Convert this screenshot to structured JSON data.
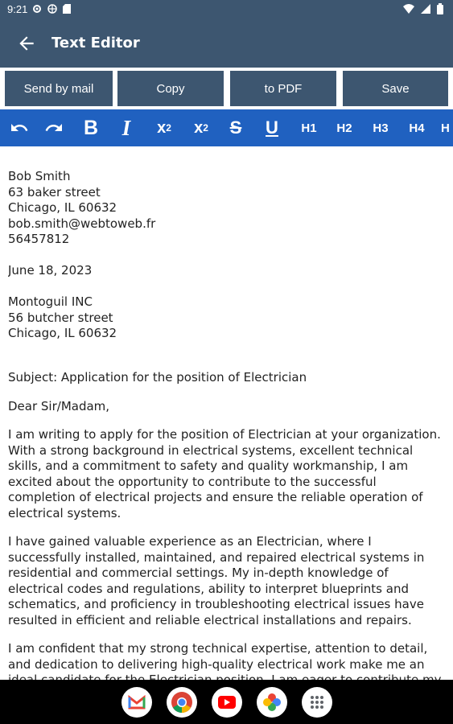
{
  "status": {
    "time": "9:21"
  },
  "app": {
    "title": "Text Editor"
  },
  "actions": {
    "send": "Send by mail",
    "copy": "Copy",
    "pdf": "to PDF",
    "save": "Save"
  },
  "toolbar": {
    "h1": "H1",
    "h2": "H2",
    "h3": "H3",
    "h4": "H4",
    "h5": "H"
  },
  "letter": {
    "sender": [
      "Bob Smith",
      "63 baker street",
      "Chicago, IL 60632",
      "bob.smith@webtoweb.fr",
      "56457812"
    ],
    "date": "June 18, 2023",
    "recipient": [
      "Montoguil INC",
      "56 butcher street",
      "Chicago, IL 60632"
    ],
    "subject": "Subject: Application for the position of Electrician",
    "greeting": "Dear Sir/Madam,",
    "para1": "I am writing to apply for the position of Electrician at your organization. With a strong background in electrical systems, excellent technical skills, and a commitment to safety and quality workmanship, I am excited about the opportunity to contribute to the successful completion of electrical projects and ensure the reliable operation of electrical systems.",
    "para2": "I have gained valuable experience as an Electrician, where I successfully installed, maintained, and repaired electrical systems in residential and commercial settings. My in-depth knowledge of electrical codes and regulations, ability to interpret blueprints and schematics, and proficiency in troubleshooting electrical issues have resulted in efficient and reliable electrical installations and repairs.",
    "para3": "I am confident that my strong technical expertise, attention to detail, and dedication to delivering high-quality electrical work make me an ideal candidate for the Electrician position. I am eager to contribute my skills"
  },
  "dock": [
    "gmail-icon",
    "chrome-icon",
    "youtube-icon",
    "photos-icon",
    "apps-icon"
  ]
}
